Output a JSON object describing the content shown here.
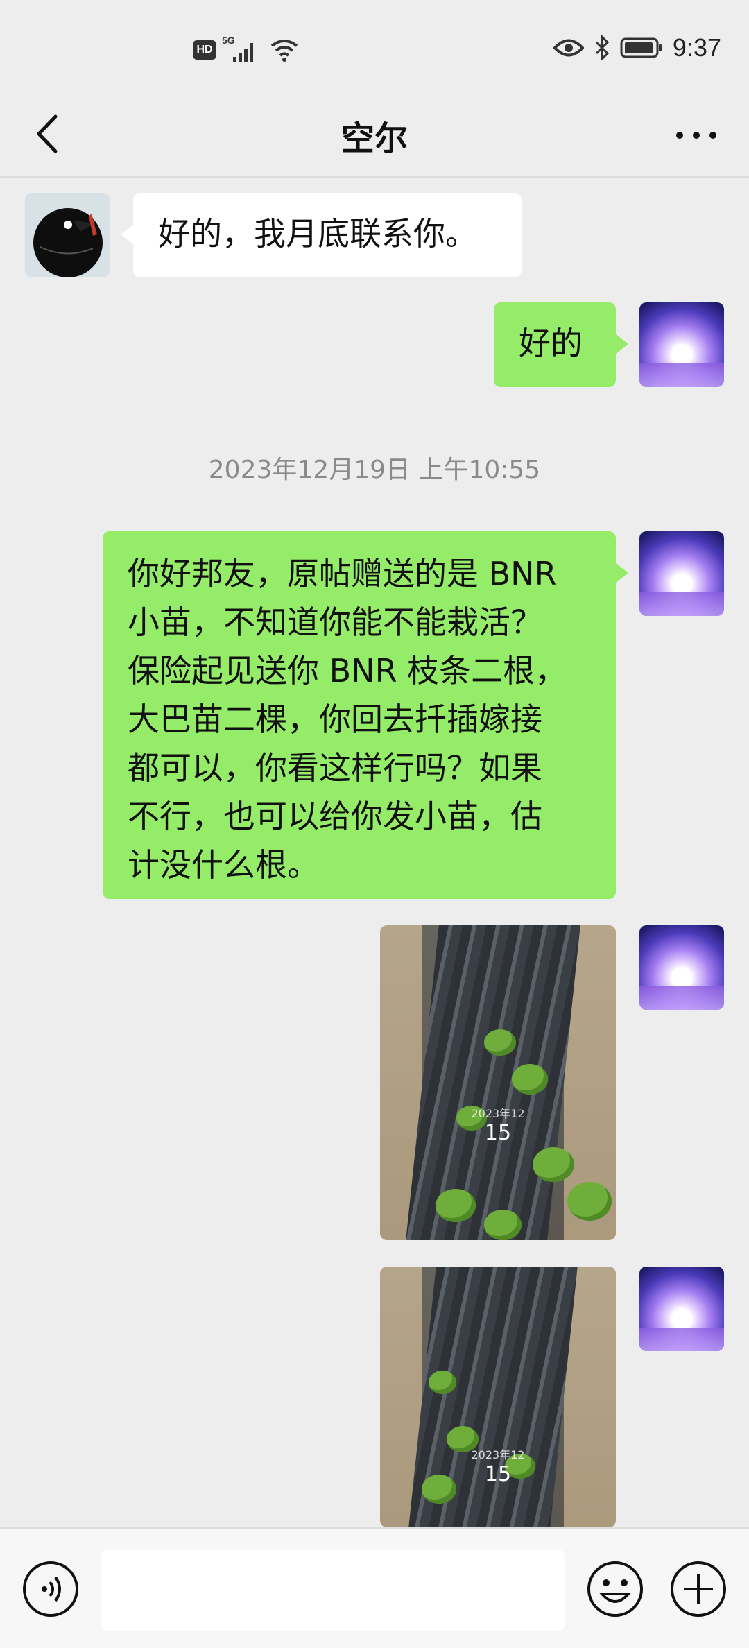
{
  "status_bar": {
    "hd_badge": "HD",
    "network_label": "5G",
    "time": "9:37",
    "icons": [
      "hd-badge",
      "signal-icon",
      "wifi-icon",
      "eye-icon",
      "bluetooth-icon",
      "battery-icon"
    ]
  },
  "header": {
    "title": "空尔",
    "back_icon": "chevron-left-icon",
    "more_icon": "more-dots-icon"
  },
  "messages": [
    {
      "sender": "other",
      "type": "text",
      "text": "好的，我月底联系你。"
    },
    {
      "sender": "me",
      "type": "text",
      "text": "好的"
    },
    {
      "type": "timestamp",
      "text": "2023年12月19日 上午10:55"
    },
    {
      "sender": "me",
      "type": "text",
      "lines": [
        "你好邦友，原帖赠送的是 BNR",
        "小苗，不知道你能不能栽活？",
        "保险起见送你 BNR 枝条二根，",
        "大巴苗二棵，你回去扦插嫁接",
        "都可以，你看这样行吗？如果",
        "不行，也可以给你发小苗，估",
        "计没什么根。"
      ]
    },
    {
      "sender": "me",
      "type": "image",
      "overlay_day": "15",
      "overlay_date": "2023年12"
    },
    {
      "sender": "me",
      "type": "image",
      "overlay_day": "15",
      "overlay_date": "2023年12"
    }
  ],
  "input_bar": {
    "placeholder": "",
    "icons": [
      "voice-icon",
      "emoji-icon",
      "plus-icon"
    ]
  },
  "colors": {
    "background": "#ededed",
    "sent_bubble": "#95ec69",
    "received_bubble": "#ffffff"
  }
}
